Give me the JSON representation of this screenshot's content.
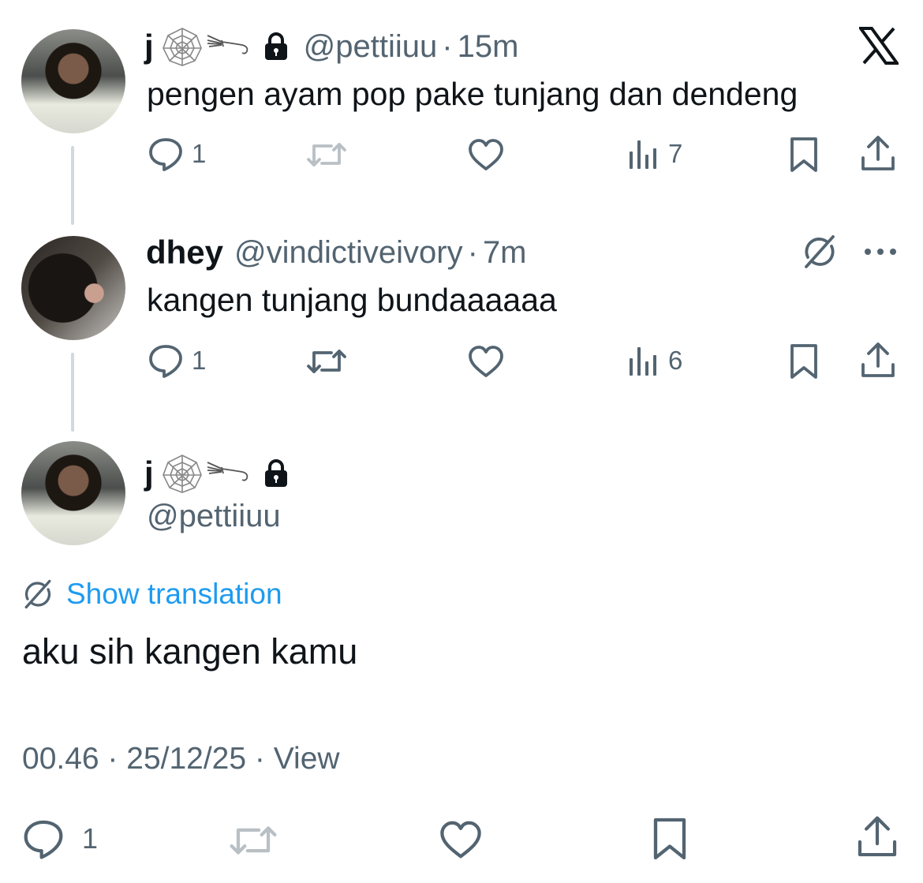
{
  "tweets": [
    {
      "name": "j",
      "handle": "@pettiiuu",
      "time": "15m",
      "text": "pengen ayam pop pake tunjang dan dendeng",
      "actions": {
        "reply_count": "1",
        "views_count": "7"
      }
    },
    {
      "name": "dhey",
      "handle": "@vindictiveivory",
      "time": "7m",
      "text": "kangen tunjang bundaaaaaa",
      "actions": {
        "reply_count": "1",
        "views_count": "6"
      }
    }
  ],
  "main_tweet": {
    "name": "j",
    "handle": "@pettiiuu",
    "translate_label": "Show translation",
    "text": "aku sih kangen kamu",
    "meta": "00.46 · 25/12/25 · View",
    "actions": {
      "reply_count": "1"
    }
  },
  "colors": {
    "muted": "#536471",
    "link": "#1d9bf0",
    "thread_line": "#cfd9de"
  },
  "icons": [
    "x-logo-icon",
    "lock-icon",
    "web-emoji-icon",
    "broom-emoji-icon",
    "reply-icon",
    "retweet-icon",
    "like-icon",
    "views-icon",
    "bookmark-icon",
    "share-icon",
    "grok-icon",
    "more-icon",
    "globe-translate-icon"
  ]
}
